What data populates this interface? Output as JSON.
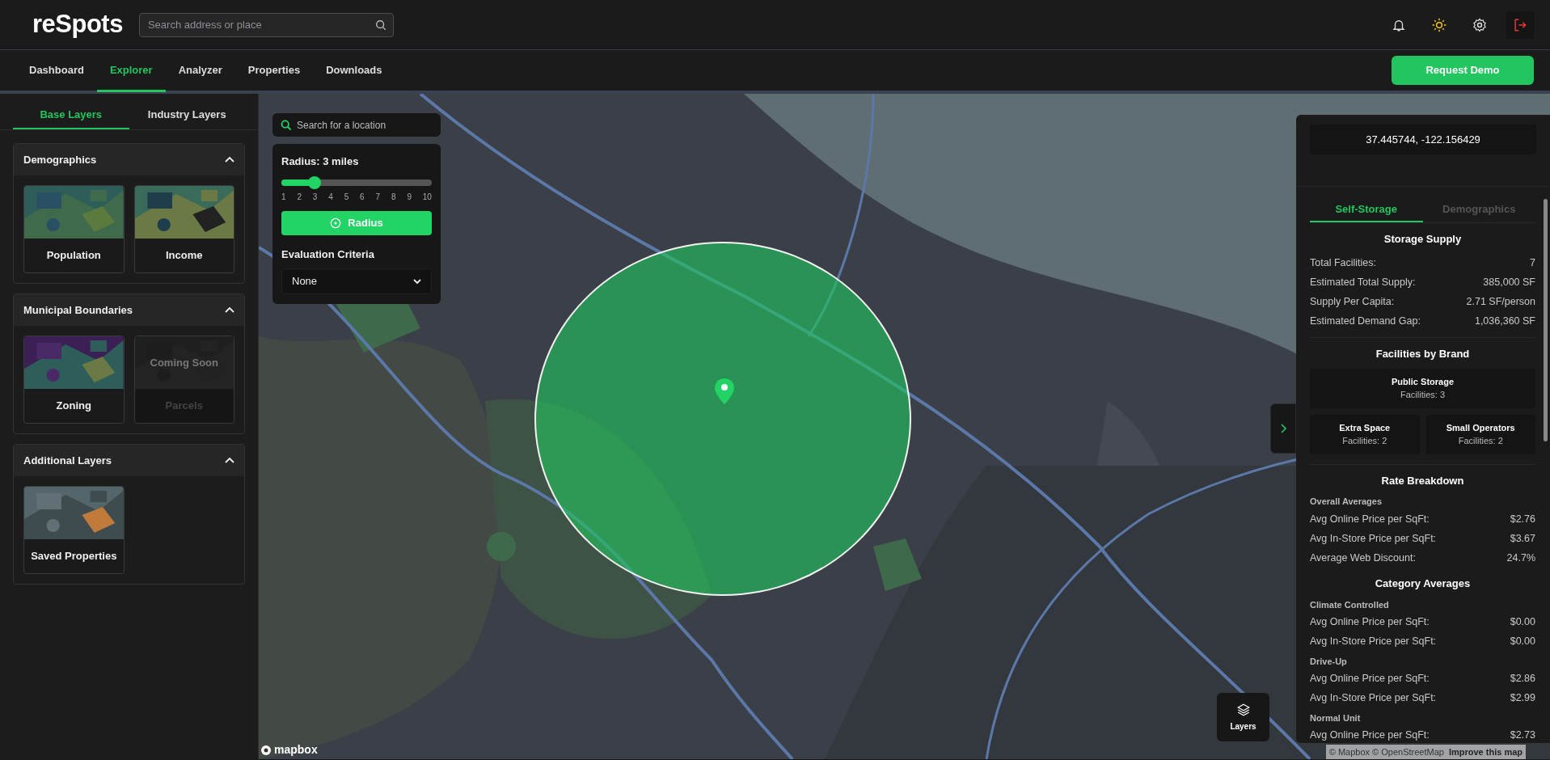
{
  "header": {
    "logo": "reSpots",
    "search": {
      "placeholder": "Search address or place"
    }
  },
  "nav": {
    "tabs": [
      {
        "label": "Dashboard",
        "selected": false
      },
      {
        "label": "Explorer",
        "selected": true
      },
      {
        "label": "Analyzer",
        "selected": false
      },
      {
        "label": "Properties",
        "selected": false
      },
      {
        "label": "Downloads",
        "selected": false
      }
    ],
    "button": "Request Demo"
  },
  "sidebar": {
    "tabs": [
      {
        "label": "Base Layers",
        "selected": true
      },
      {
        "label": "Industry Layers",
        "selected": false
      }
    ],
    "sections": [
      {
        "title": "Demographics",
        "expanded": true,
        "layers": [
          {
            "label": "Population",
            "disabled": false
          },
          {
            "label": "Income",
            "disabled": false
          }
        ]
      },
      {
        "title": "Municipal Boundaries",
        "expanded": true,
        "layers": [
          {
            "label": "Zoning",
            "disabled": false
          },
          {
            "label": "Parcels",
            "disabled": true,
            "overlay": "Coming Soon"
          }
        ]
      },
      {
        "title": "Additional Layers",
        "expanded": true,
        "layers": [
          {
            "label": "Saved Properties",
            "disabled": false
          }
        ]
      }
    ]
  },
  "map": {
    "location_search": {
      "placeholder": "Search for a location"
    },
    "radius": {
      "label": "Radius: 3 miles",
      "level": 0.222,
      "ticks": [
        "1",
        "2",
        "3",
        "4",
        "5",
        "6",
        "7",
        "8",
        "9",
        "10"
      ],
      "button": "Radius"
    },
    "criteria": {
      "label": "Evaluation Criteria",
      "value": "None"
    },
    "layers_button": "Layers",
    "attribution": {
      "logo": "mapbox",
      "text": "© Mapbox © OpenStreetMap",
      "link": "Improve this map"
    }
  },
  "details": {
    "coordinates": "37.445744, -122.156429",
    "tabs": [
      {
        "label": "Self-Storage",
        "selected": true
      },
      {
        "label": "Demographics",
        "selected": false
      }
    ],
    "sections": [
      {
        "kind": "rows",
        "title": "Storage Supply",
        "groups": [
          {
            "rows": [
              {
                "label": "Total Facilities:",
                "value": "7"
              },
              {
                "label": "Estimated Total Supply:",
                "value": "385,000 SF"
              },
              {
                "label": "Supply Per Capita:",
                "value": "2.71 SF/person"
              },
              {
                "label": "Estimated Demand Gap:",
                "value": "1,036,360 SF"
              }
            ]
          }
        ]
      },
      {
        "kind": "brands",
        "title": "Facilities by Brand",
        "brands": [
          {
            "name": "Public Storage",
            "count": "Facilities: 3"
          },
          {
            "name": "Extra Space",
            "count": "Facilities: 2"
          },
          {
            "name": "Small Operators",
            "count": "Facilities: 2"
          }
        ]
      },
      {
        "kind": "rows",
        "title": "Rate Breakdown",
        "groups": [
          {
            "subtitle": "Overall Averages",
            "rows": [
              {
                "label": "Avg Online Price per SqFt:",
                "value": "$2.76"
              },
              {
                "label": "Avg In-Store Price per SqFt:",
                "value": "$3.67"
              },
              {
                "label": "Average Web Discount:",
                "value": "24.7%"
              }
            ]
          }
        ]
      },
      {
        "kind": "rows",
        "title": "Category Averages",
        "groups": [
          {
            "subtitle": "Climate Controlled",
            "rows": [
              {
                "label": "Avg Online Price per SqFt:",
                "value": "$0.00"
              },
              {
                "label": "Avg In-Store Price per SqFt:",
                "value": "$0.00"
              }
            ]
          },
          {
            "subtitle": "Drive-Up",
            "rows": [
              {
                "label": "Avg Online Price per SqFt:",
                "value": "$2.86"
              },
              {
                "label": "Avg In-Store Price per SqFt:",
                "value": "$2.99"
              }
            ]
          },
          {
            "subtitle": "Normal Unit",
            "rows": [
              {
                "label": "Avg Online Price per SqFt:",
                "value": "$2.73"
              }
            ]
          }
        ]
      }
    ]
  }
}
